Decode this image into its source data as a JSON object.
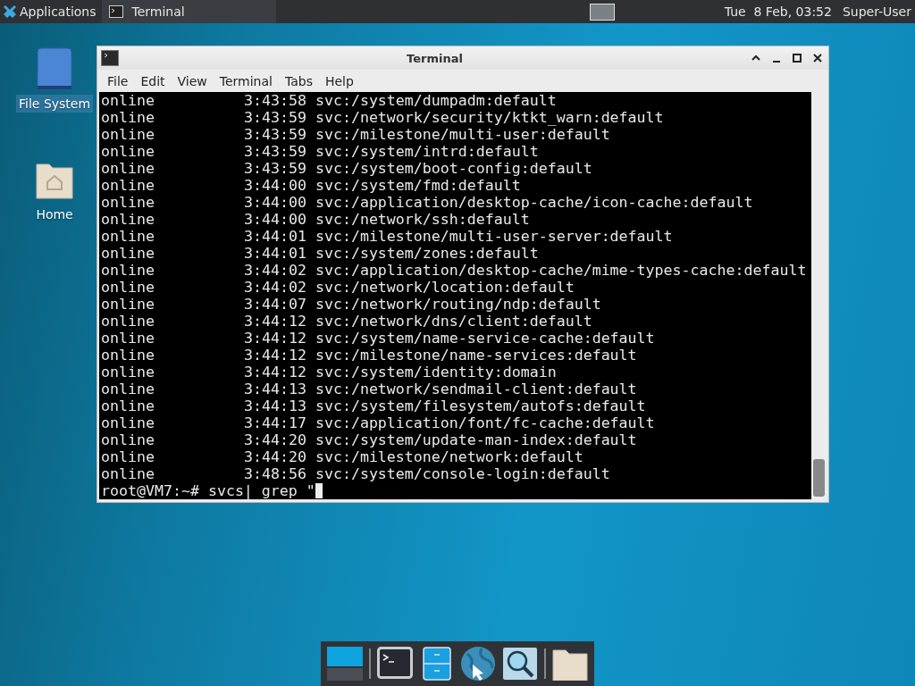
{
  "top_panel": {
    "applications_menu": "Applications",
    "task_button": {
      "label": "Terminal",
      "selected": true
    },
    "clock": "Tue  8 Feb, 03:52",
    "user": "Super-User"
  },
  "desktop_icons": [
    {
      "kind": "drive",
      "label": "File System",
      "selected": true
    },
    {
      "kind": "home",
      "label": "Home",
      "selected": false
    }
  ],
  "window": {
    "title": "Terminal",
    "menu": [
      "File",
      "Edit",
      "View",
      "Terminal",
      "Tabs",
      "Help"
    ],
    "lines": [
      {
        "state": "online",
        "time": "3:43:58",
        "fmri": "svc:/system/dumpadm:default"
      },
      {
        "state": "online",
        "time": "3:43:59",
        "fmri": "svc:/network/security/ktkt_warn:default"
      },
      {
        "state": "online",
        "time": "3:43:59",
        "fmri": "svc:/milestone/multi-user:default"
      },
      {
        "state": "online",
        "time": "3:43:59",
        "fmri": "svc:/system/intrd:default"
      },
      {
        "state": "online",
        "time": "3:43:59",
        "fmri": "svc:/system/boot-config:default"
      },
      {
        "state": "online",
        "time": "3:44:00",
        "fmri": "svc:/system/fmd:default"
      },
      {
        "state": "online",
        "time": "3:44:00",
        "fmri": "svc:/application/desktop-cache/icon-cache:default"
      },
      {
        "state": "online",
        "time": "3:44:00",
        "fmri": "svc:/network/ssh:default"
      },
      {
        "state": "online",
        "time": "3:44:01",
        "fmri": "svc:/milestone/multi-user-server:default"
      },
      {
        "state": "online",
        "time": "3:44:01",
        "fmri": "svc:/system/zones:default"
      },
      {
        "state": "online",
        "time": "3:44:02",
        "fmri": "svc:/application/desktop-cache/mime-types-cache:default"
      },
      {
        "state": "online",
        "time": "3:44:02",
        "fmri": "svc:/network/location:default"
      },
      {
        "state": "online",
        "time": "3:44:07",
        "fmri": "svc:/network/routing/ndp:default"
      },
      {
        "state": "online",
        "time": "3:44:12",
        "fmri": "svc:/network/dns/client:default"
      },
      {
        "state": "online",
        "time": "3:44:12",
        "fmri": "svc:/system/name-service-cache:default"
      },
      {
        "state": "online",
        "time": "3:44:12",
        "fmri": "svc:/milestone/name-services:default"
      },
      {
        "state": "online",
        "time": "3:44:12",
        "fmri": "svc:/system/identity:domain"
      },
      {
        "state": "online",
        "time": "3:44:13",
        "fmri": "svc:/network/sendmail-client:default"
      },
      {
        "state": "online",
        "time": "3:44:13",
        "fmri": "svc:/system/filesystem/autofs:default"
      },
      {
        "state": "online",
        "time": "3:44:17",
        "fmri": "svc:/application/font/fc-cache:default"
      },
      {
        "state": "online",
        "time": "3:44:20",
        "fmri": "svc:/system/update-man-index:default"
      },
      {
        "state": "online",
        "time": "3:44:20",
        "fmri": "svc:/milestone/network:default"
      },
      {
        "state": "online",
        "time": "3:48:56",
        "fmri": "svc:/system/console-login:default"
      }
    ],
    "prompt": "root@VM7:~#",
    "command": "svcs| grep \""
  },
  "dock": [
    {
      "kind": "workspaces"
    },
    {
      "kind": "terminal"
    },
    {
      "kind": "files"
    },
    {
      "kind": "browser"
    },
    {
      "kind": "search"
    },
    {
      "kind": "folder"
    }
  ]
}
